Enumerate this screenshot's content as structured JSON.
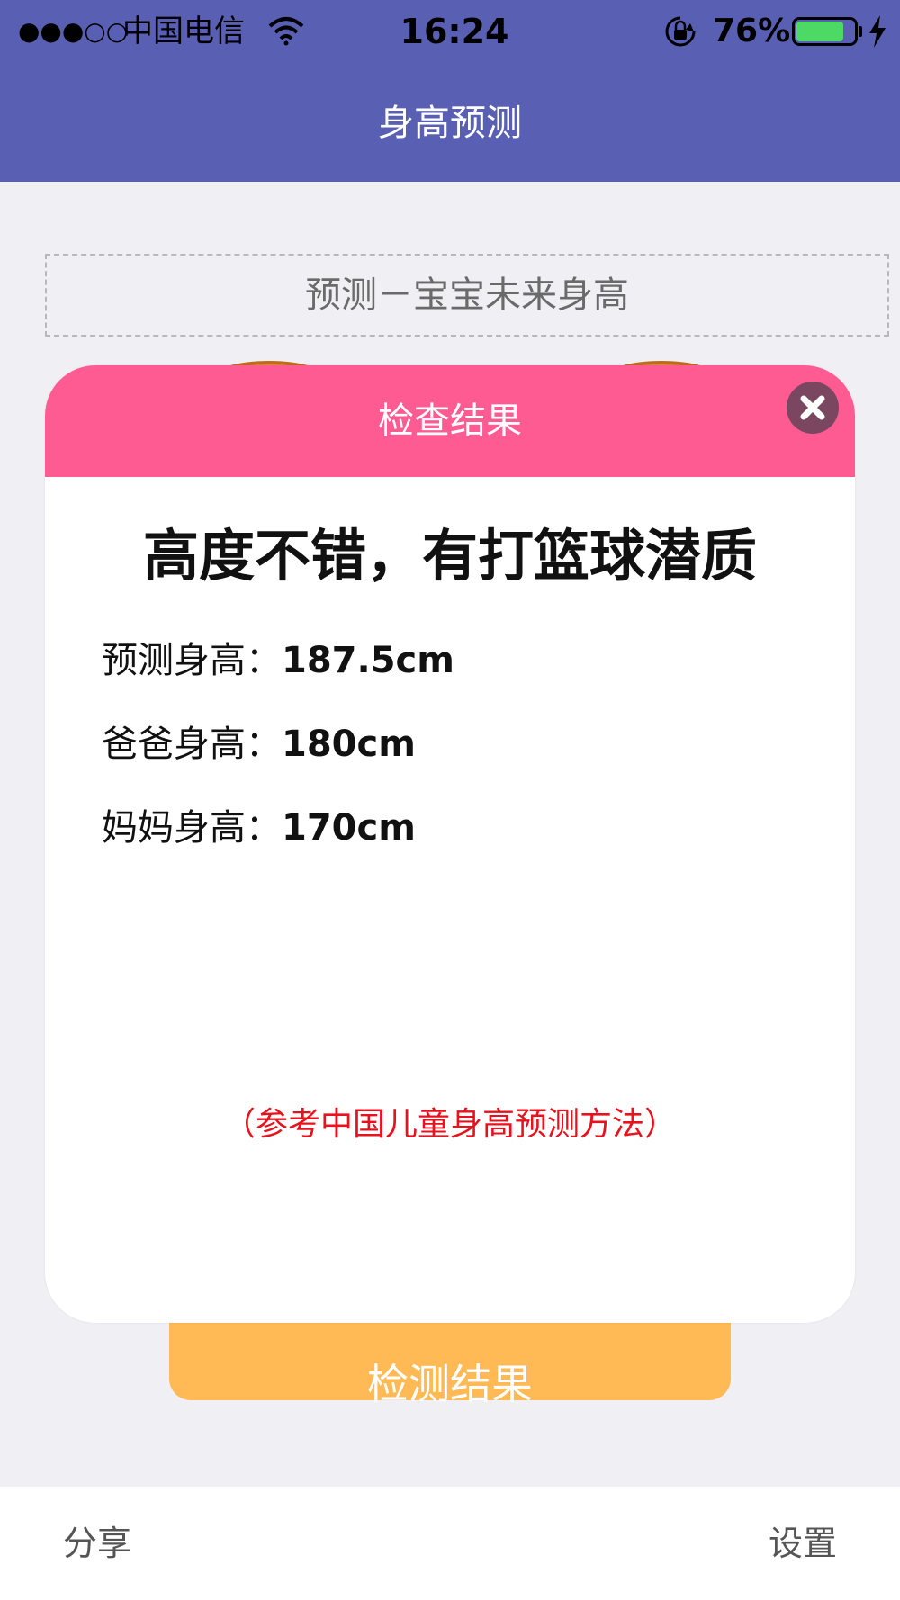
{
  "status_bar": {
    "signal": "●●●○○",
    "carrier": "中国电信",
    "time": "16:24",
    "battery_percent": "76%",
    "icons": [
      "wifi-icon",
      "rotation-lock-icon",
      "battery-icon",
      "charging-icon"
    ]
  },
  "nav": {
    "title": "身高预测"
  },
  "content": {
    "predict_header": "预测－宝宝未来身高",
    "detect_button": "检测结果"
  },
  "modal": {
    "title": "检查结果",
    "headline": "高度不错，有打篮球潜质",
    "rows": [
      {
        "label": "预测身高：",
        "value": "187.5cm"
      },
      {
        "label": "爸爸身高：",
        "value": "180cm"
      },
      {
        "label": "妈妈身高：",
        "value": "170cm"
      }
    ],
    "note": "（参考中国儿童身高预测方法）"
  },
  "bottom_bar": {
    "share": "分享",
    "settings": "设置"
  },
  "colors": {
    "nav_bg": "#5960b4",
    "modal_header": "#fd5b92",
    "detect_button": "#ffb955",
    "note_text": "#e8121d",
    "page_bg": "#efeff4"
  }
}
